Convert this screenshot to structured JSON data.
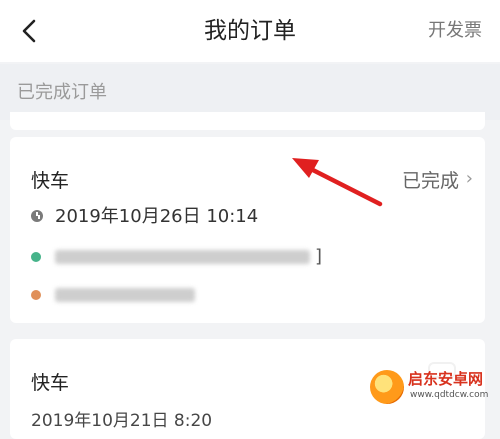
{
  "nav": {
    "title": "我的订单",
    "invoice_label": "开发票",
    "back_icon": "chevron-left-icon"
  },
  "section": {
    "label": "已完成订单"
  },
  "orders": [
    {
      "type": "快车",
      "status": "已完成",
      "time": "2019年10月26日 10:14",
      "start_marker_color": "#46b38a",
      "end_marker_color": "#e0905a",
      "start_suffix": "]"
    },
    {
      "type": "快车",
      "time": "2019年10月21日 8:20"
    }
  ],
  "watermark": {
    "title": "启东安卓网",
    "url": "www.qdtdcw.com"
  },
  "colors": {
    "annotation_arrow": "#e02020",
    "background": "#f2f3f5"
  }
}
